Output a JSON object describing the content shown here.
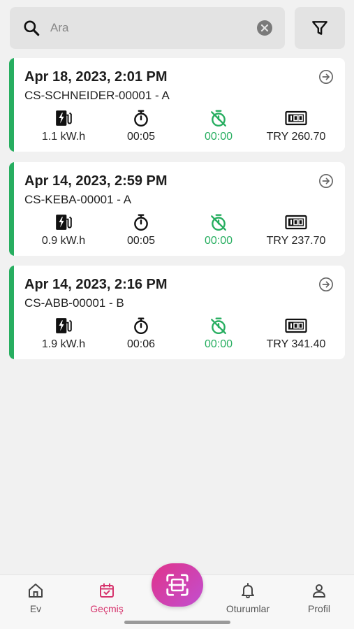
{
  "search": {
    "placeholder": "Ara",
    "value": ""
  },
  "sessions": [
    {
      "date": "Apr 18, 2023, 2:01 PM",
      "station": "CS-SCHNEIDER-00001 - A",
      "energy": "1.1 kW.h",
      "duration": "00:05",
      "idle_time": "00:00",
      "cost": "TRY 260.70"
    },
    {
      "date": "Apr 14, 2023, 2:59 PM",
      "station": "CS-KEBA-00001 - A",
      "energy": "0.9 kW.h",
      "duration": "00:05",
      "idle_time": "00:00",
      "cost": "TRY 237.70"
    },
    {
      "date": "Apr 14, 2023, 2:16 PM",
      "station": "CS-ABB-00001 - B",
      "energy": "1.9 kW.h",
      "duration": "00:06",
      "idle_time": "00:00",
      "cost": "TRY 341.40"
    }
  ],
  "nav": {
    "items": [
      {
        "label": "Ev",
        "icon": "home-icon"
      },
      {
        "label": "Geçmiş",
        "icon": "calendar-check-icon",
        "active": true
      },
      {
        "label": "Oturumlar",
        "icon": "bell-icon"
      },
      {
        "label": "Profil",
        "icon": "person-icon"
      }
    ],
    "center_icon": "scan-icon"
  },
  "colors": {
    "accent_green": "#27ae60",
    "accent_pink": "#d6336c",
    "fab_gradient_start": "#e0338a",
    "fab_gradient_end": "#c24fd0"
  }
}
